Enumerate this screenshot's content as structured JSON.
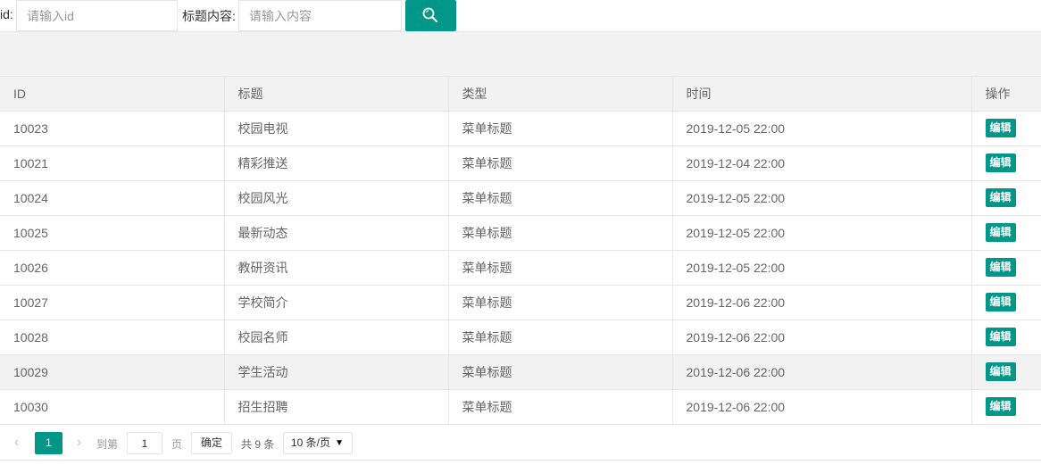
{
  "search": {
    "id_label": "id:",
    "id_placeholder": "请输入id",
    "title_label": "标题内容:",
    "title_placeholder": "请输入内容"
  },
  "table": {
    "columns": [
      "ID",
      "标题",
      "类型",
      "时间",
      "操作"
    ],
    "rows": [
      {
        "id": "10023",
        "title": "校园电视",
        "type": "菜单标题",
        "time": "2019-12-05 22:00",
        "action": "编辑"
      },
      {
        "id": "10021",
        "title": "精彩推送",
        "type": "菜单标题",
        "time": "2019-12-04 22:00",
        "action": "编辑"
      },
      {
        "id": "10024",
        "title": "校园风光",
        "type": "菜单标题",
        "time": "2019-12-05 22:00",
        "action": "编辑"
      },
      {
        "id": "10025",
        "title": "最新动态",
        "type": "菜单标题",
        "time": "2019-12-05 22:00",
        "action": "编辑"
      },
      {
        "id": "10026",
        "title": "教研资讯",
        "type": "菜单标题",
        "time": "2019-12-05 22:00",
        "action": "编辑"
      },
      {
        "id": "10027",
        "title": "学校简介",
        "type": "菜单标题",
        "time": "2019-12-06 22:00",
        "action": "编辑"
      },
      {
        "id": "10028",
        "title": "校园名师",
        "type": "菜单标题",
        "time": "2019-12-06 22:00",
        "action": "编辑"
      },
      {
        "id": "10029",
        "title": "学生活动",
        "type": "菜单标题",
        "time": "2019-12-06 22:00",
        "action": "编辑"
      },
      {
        "id": "10030",
        "title": "招生招聘",
        "type": "菜单标题",
        "time": "2019-12-06 22:00",
        "action": "编辑"
      }
    ]
  },
  "pager": {
    "prev_icon": "‹",
    "current_page": "1",
    "next_icon": "›",
    "goto_label": "到第",
    "goto_value": "1",
    "page_unit": "页",
    "confirm_label": "确定",
    "total_label": "共 9 条",
    "page_size": "10 条/页"
  },
  "colors": {
    "accent": "#009688",
    "header_bg": "#f2f2f2",
    "border": "#e6e6e6"
  }
}
